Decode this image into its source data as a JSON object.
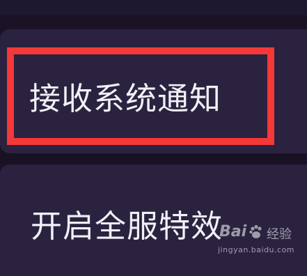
{
  "settings": {
    "items": [
      {
        "label": "接收系统通知"
      },
      {
        "label": "开启全服特效"
      }
    ]
  },
  "watermark": {
    "brand_latin": "Bai",
    "brand_cn": "经验",
    "url": "jingyan.baidu.com"
  },
  "colors": {
    "background": "#191325",
    "card": "#2b2240",
    "highlight": "#f53838",
    "text": "#f2f0f6"
  }
}
